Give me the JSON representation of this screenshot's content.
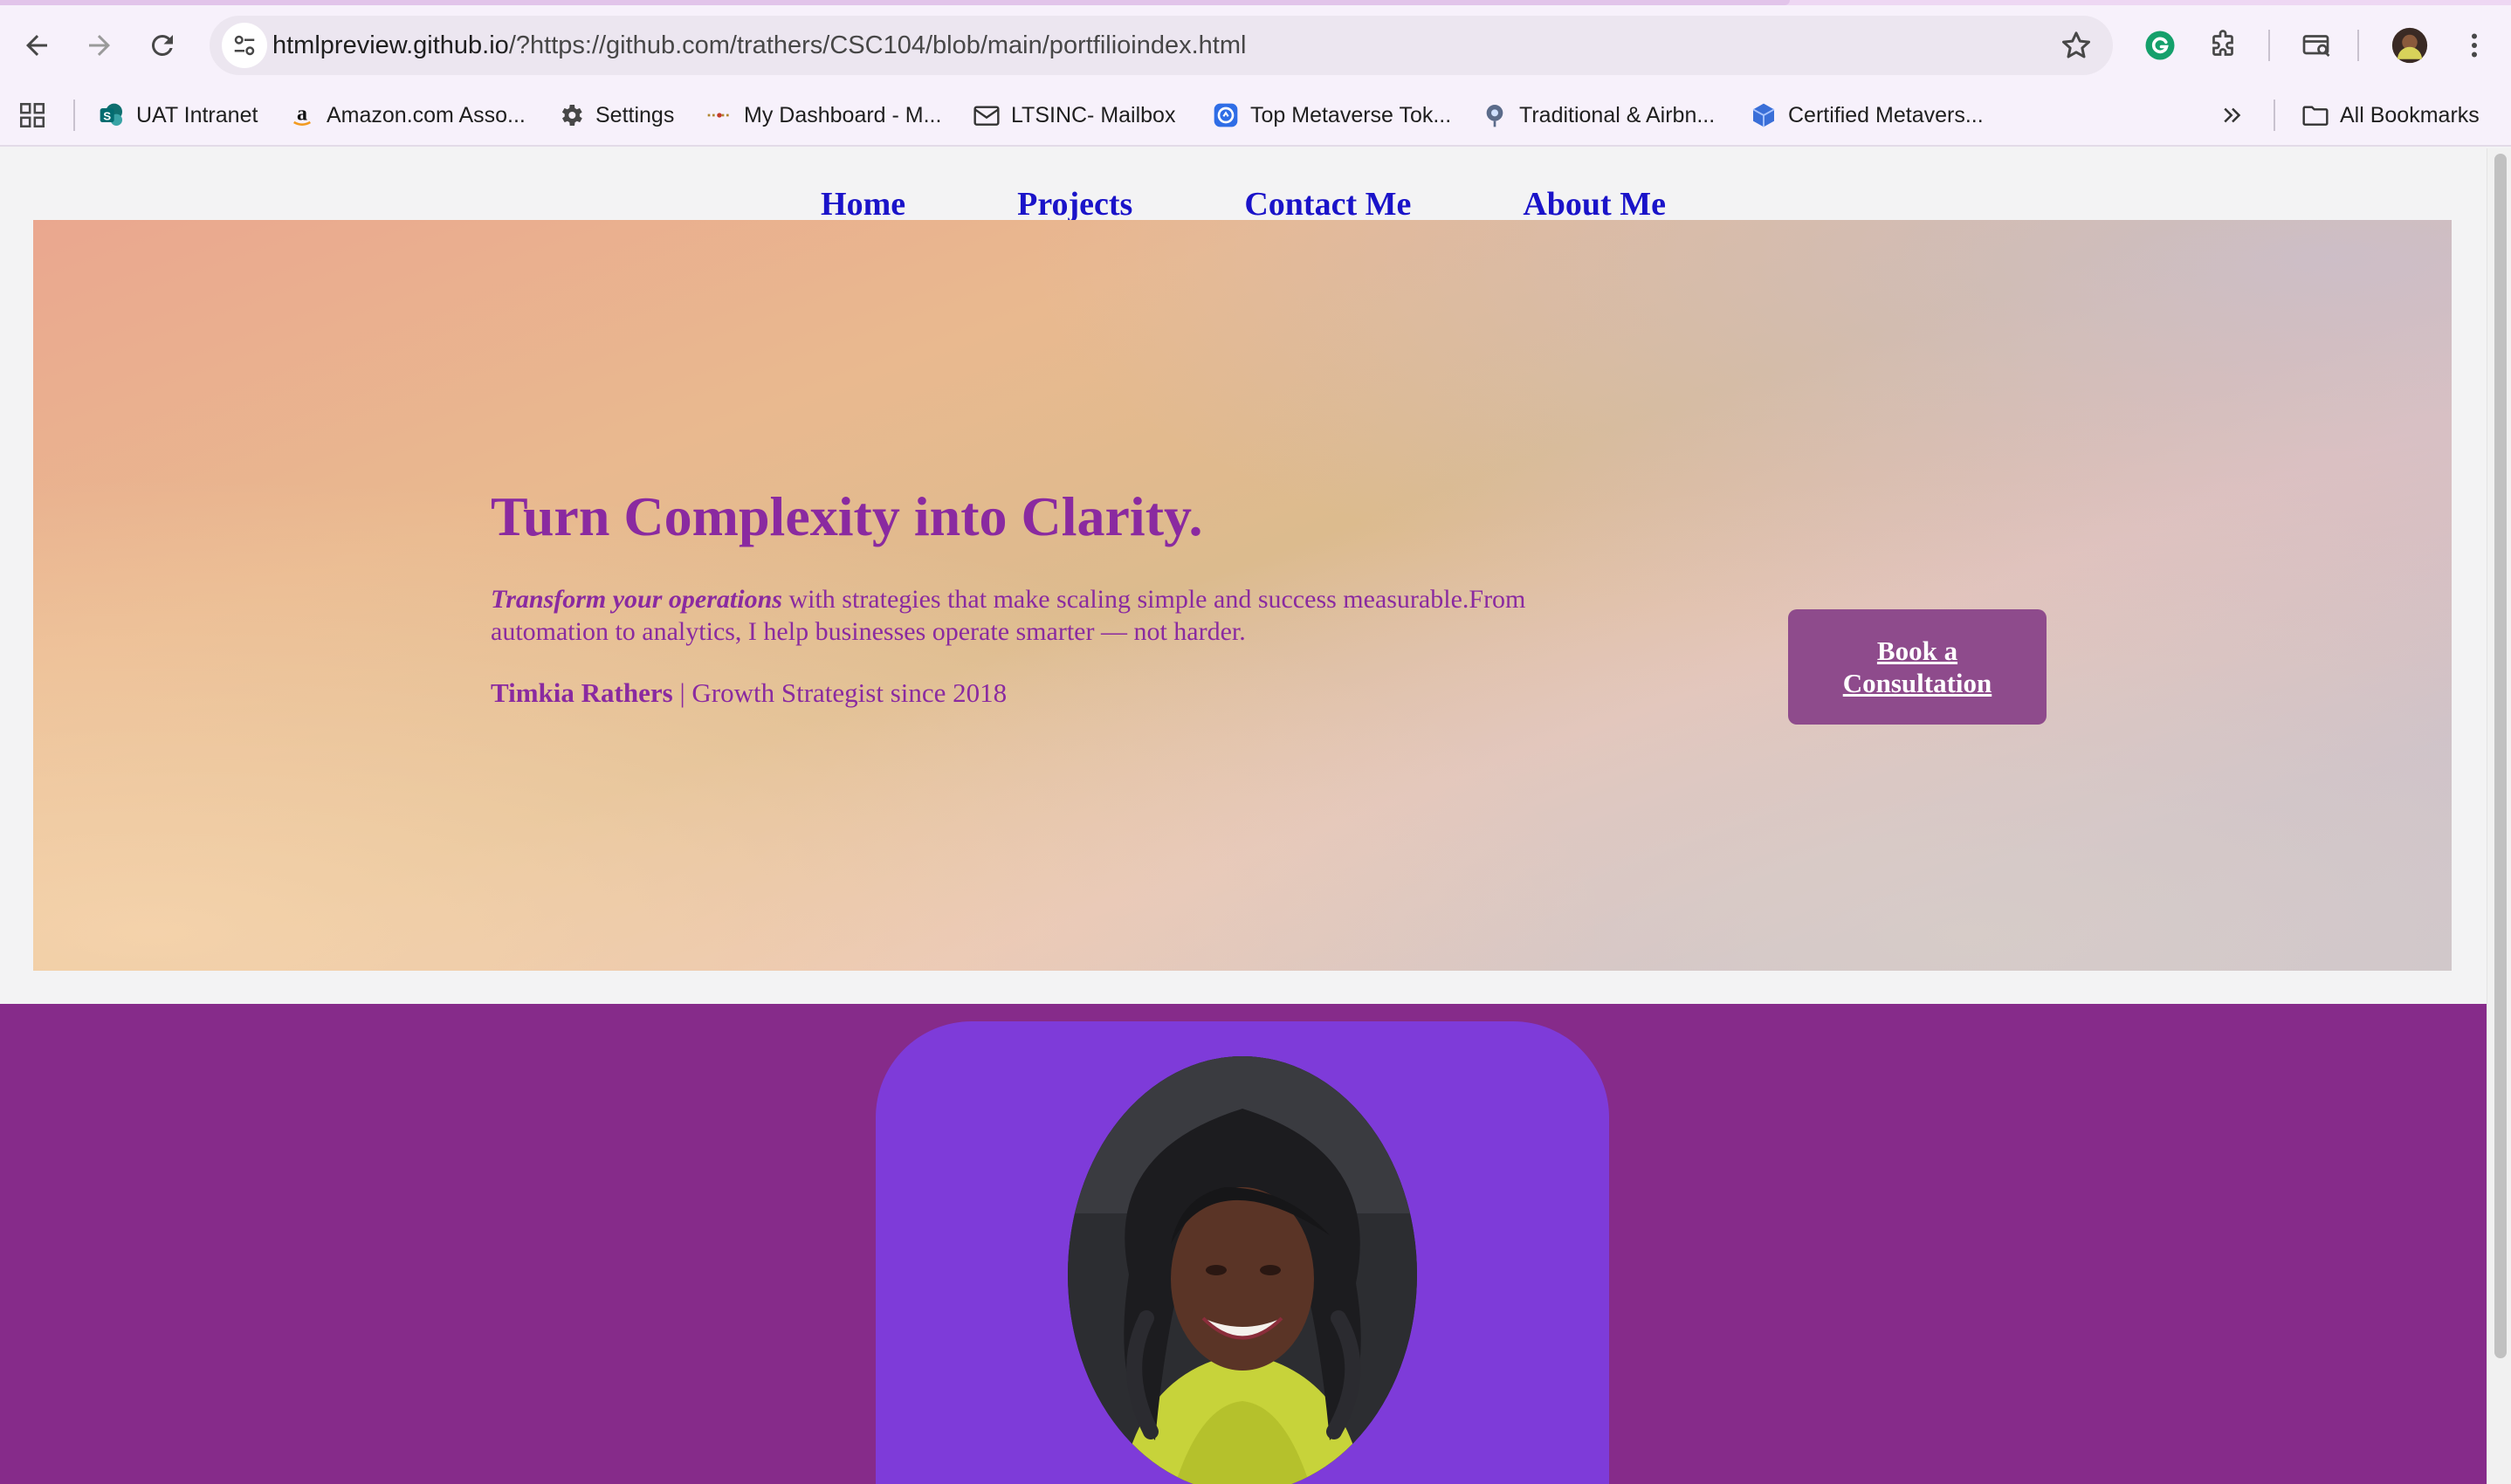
{
  "browser": {
    "url_host": "htmlpreview.github.io",
    "url_path": "/?https://github.com/trathers/CSC104/blob/main/portfilioindex.html",
    "bookmarks": [
      {
        "label": "UAT Intranet",
        "icon": "sharepoint-icon"
      },
      {
        "label": "Amazon.com Asso...",
        "icon": "amazon-icon"
      },
      {
        "label": "Settings",
        "icon": "gear-icon"
      },
      {
        "label": "My Dashboard - M...",
        "icon": "dashboard-icon"
      },
      {
        "label": "LTSINC- Mailbox",
        "icon": "mail-icon"
      },
      {
        "label": "Top Metaverse Tok...",
        "icon": "coin-icon"
      },
      {
        "label": "Traditional & Airbn...",
        "icon": "globe-pin-icon"
      },
      {
        "label": "Certified Metavers...",
        "icon": "cube-icon"
      }
    ],
    "all_bookmarks_label": "All Bookmarks",
    "colors": {
      "chrome_bg": "#f7f1fb",
      "omnibox_bg": "#ece6f0"
    }
  },
  "site": {
    "nav": [
      {
        "label": "Home"
      },
      {
        "label": "Projects"
      },
      {
        "label": "Contact Me"
      },
      {
        "label": "About Me"
      }
    ],
    "hero": {
      "title": "Turn Complexity into Clarity.",
      "desc_emphasis": "Transform your operations",
      "desc_rest": " with strategies that make scaling simple and success measurable.From automation to analytics, I help businesses operate smarter — not harder.",
      "byline_name": "Timkia Rathers",
      "byline_rest": " | Growth Strategist since 2018",
      "cta_label": "Book a Consultation"
    },
    "colors": {
      "nav_link": "#1a13c9",
      "hero_text": "#8a2aa0",
      "cta_bg": "#8e4b8c",
      "about_bg": "#862b8a",
      "photo_card_bg": "#7e3bd9"
    }
  }
}
